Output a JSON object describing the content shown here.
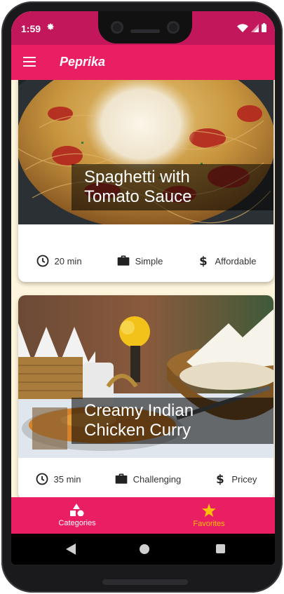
{
  "status_bar": {
    "time": "1:59",
    "icons": [
      "gear-icon",
      "wifi-icon",
      "signal-icon",
      "battery-icon"
    ]
  },
  "app_bar": {
    "title": "Peprika",
    "menu_icon": "hamburger-icon"
  },
  "meals": [
    {
      "title": "Spaghetti with Tomato Sauce",
      "title_line1": "Spaghetti with",
      "title_line2": "Tomato Sauce",
      "duration": "20 min",
      "complexity": "Simple",
      "affordability": "Affordable"
    },
    {
      "title": "Creamy Indian Chicken Curry",
      "title_line1": "Creamy Indian",
      "title_line2": "Chicken Curry",
      "duration": "35 min",
      "complexity": "Challenging",
      "affordability": "Pricey"
    }
  ],
  "bottom_nav": {
    "items": [
      {
        "label": "Categories",
        "icon": "shapes-icon",
        "active": false
      },
      {
        "label": "Favorites",
        "icon": "star-icon",
        "active": true
      }
    ]
  },
  "colors": {
    "primary": "#e91e63",
    "status_bar": "#c2185b",
    "accent": "#ffc107",
    "background": "#fdf5dc"
  }
}
